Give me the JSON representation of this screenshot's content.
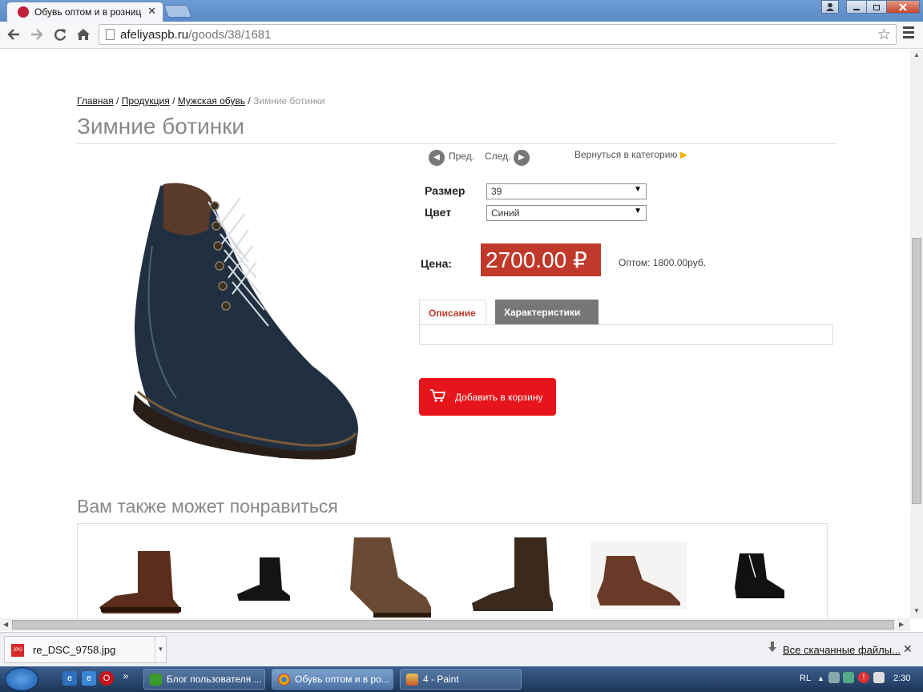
{
  "browser": {
    "tab_title": "Обувь оптом и в розниц",
    "tab_close": "✕",
    "url_domain": "afeliyaspb.ru",
    "url_path": "/goods/38/1681",
    "bookmark_star": "☆",
    "window_buttons": [
      "🗕",
      "🗗",
      "✕"
    ]
  },
  "page": {
    "breadcrumb": {
      "items": [
        "Главная",
        "Продукция",
        "Мужская обувь"
      ],
      "current": "Зимние ботинки",
      "separator": " / "
    },
    "title": "Зимние ботинки",
    "prev_label": "Пред.",
    "next_label": "След.",
    "back_to_category": "Вернуться в категорию",
    "size_label": "Размер",
    "size_value": "39",
    "color_label": "Цвет",
    "color_value": "Синий",
    "price_label": "Цена:",
    "price_value": "2700.00 ₽",
    "wholesale": "Оптом: 1800.00руб.",
    "tabs": [
      {
        "label": "Описание",
        "active": true
      },
      {
        "label": "Характеристики",
        "active": false
      }
    ],
    "add_to_cart": "Добавить в корзину",
    "also_like_title": "Вам также может понравиться",
    "accent_color": "#c0392b",
    "cart_color": "#e6141b"
  },
  "downloads": {
    "file_name": "re_DSC_9758.jpg",
    "file_type": "JPG",
    "all_downloads": "Все скачанные файлы..."
  },
  "taskbar": {
    "apps": [
      "Блог пользователя ...",
      "Обувь оптом и в ро...",
      "4 - Paint"
    ],
    "lang": "RL",
    "time": "2:30"
  }
}
